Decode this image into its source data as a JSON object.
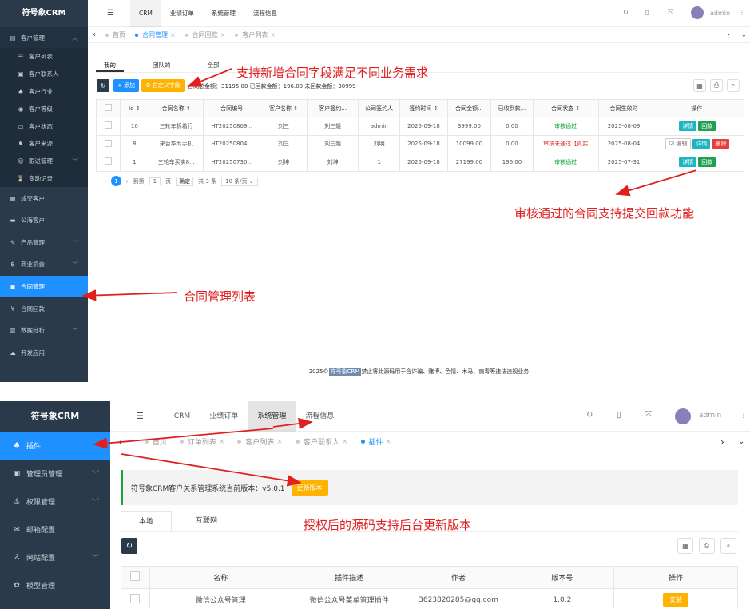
{
  "p1": {
    "logo": "符号象CRM",
    "menu": [
      {
        "label": "客户管理",
        "icon": "grid-icon",
        "chev": "︿",
        "cls": "group"
      },
      {
        "label": "客户列表",
        "icon": "list-icon",
        "cls": "sub"
      },
      {
        "label": "客户联系人",
        "icon": "contact-icon",
        "cls": "sub"
      },
      {
        "label": "客户行业",
        "icon": "industry-icon",
        "cls": "sub"
      },
      {
        "label": "客户等级",
        "icon": "level-icon",
        "cls": "sub"
      },
      {
        "label": "客户状态",
        "icon": "status-icon",
        "cls": "sub"
      },
      {
        "label": "客户来源",
        "icon": "source-icon",
        "cls": "sub"
      },
      {
        "label": "跟进管理",
        "icon": "follow-icon",
        "chev": "﹀",
        "cls": "sub"
      },
      {
        "label": "变动记录",
        "icon": "record-icon",
        "cls": "sub"
      },
      {
        "label": "成交客户",
        "icon": "deal-icon",
        "cls": "main"
      },
      {
        "label": "公海客户",
        "icon": "chart-icon",
        "cls": "main"
      },
      {
        "label": "产品管理",
        "icon": "product-icon",
        "chev": "﹀",
        "cls": "main"
      },
      {
        "label": "商业机会",
        "icon": "opportunity-icon",
        "chev": "﹀",
        "cls": "main"
      },
      {
        "label": "合同管理",
        "icon": "contract-icon",
        "cls": "main active"
      },
      {
        "label": "合同回款",
        "icon": "yen-icon",
        "cls": "main"
      },
      {
        "label": "数据分析",
        "icon": "analysis-icon",
        "chev": "﹀",
        "cls": "main"
      },
      {
        "label": "开发应用",
        "icon": "dev-icon",
        "cls": "main"
      }
    ],
    "nav": [
      "CRM",
      "业绩订单",
      "系统管理",
      "流程信息"
    ],
    "user": "admin",
    "tabs": [
      {
        "label": "首页",
        "active": false,
        "close": false
      },
      {
        "label": "合同管理",
        "active": true,
        "close": true
      },
      {
        "label": "合同回款",
        "active": false,
        "close": true
      },
      {
        "label": "客户列表",
        "active": false,
        "close": true
      }
    ],
    "subtabs": [
      "我的",
      "团队的",
      "全部"
    ],
    "add_label": "+ 添加",
    "custom_label": "⚙ 自定义字段",
    "summary": "合同总金额：31195.00  已回款金额：196.00  未回款金额：30999",
    "columns": [
      "",
      "Id ⇕",
      "合同名称 ⇕",
      "合同编号",
      "客户名称 ⇕",
      "客户签约...",
      "公司签约人",
      "签约时间 ⇕",
      "合同金额...",
      "已收到款...",
      "合同状态 ⇕",
      "合同生效时"
    ],
    "op_label": "操作",
    "rows": [
      {
        "id": "10",
        "name": "三轮车拆着行",
        "no": "HT20250809...",
        "cust": "刘三",
        "signer": "刘三姐",
        "comp": "admin",
        "date": "2025-09-18",
        "amt": "3999.00",
        "recv": "0.00",
        "status": "审核通过",
        "status_cls": "g",
        "eff": "2025-08-09",
        "ops": [
          [
            "详情",
            "blue"
          ],
          [
            "回款",
            "grn"
          ]
        ]
      },
      {
        "id": "8",
        "name": "来台华为手机",
        "no": "HT20250804...",
        "cust": "刘三",
        "signer": "刘三姐",
        "comp": "刘明",
        "date": "2025-09-18",
        "amt": "10099.00",
        "recv": "0.00",
        "status": "审核未通过【真实",
        "status_cls": "r",
        "eff": "2025-08-04",
        "ops": [
          [
            "☑ 编辑",
            "wh"
          ],
          [
            "详情",
            "blue"
          ],
          [
            "删除",
            "red"
          ]
        ]
      },
      {
        "id": "1",
        "name": "三轮车买卖8...",
        "no": "HT20250730...",
        "cust": "刘坤",
        "signer": "刘坤",
        "comp": "1",
        "date": "2025-09-18",
        "amt": "27199.00",
        "recv": "196.00",
        "status": "审核通过",
        "status_cls": "g",
        "eff": "2025-07-31",
        "ops": [
          [
            "详情",
            "blue"
          ],
          [
            "回款",
            "grn"
          ]
        ]
      }
    ],
    "pager": {
      "page": "1",
      "goto": "到第",
      "input": "1",
      "unit": "页",
      "ok": "确定",
      "total": "共 3 条",
      "size": "10 条/页 ⌄"
    },
    "footer": {
      "pre": "2025© ",
      "brand": "符号象CRM",
      "post": " 禁止将此源码用于含诈骗、赌博、色情、木马、病毒等违法违规业务"
    },
    "annotations": [
      "支持新增合同字段满足不同业务需求",
      "审核通过的合同支持提交回款功能",
      "合同管理列表"
    ]
  },
  "p2": {
    "logo": "符号象CRM",
    "menu": [
      {
        "label": "插件",
        "icon": "plugin-icon",
        "cls": "active"
      },
      {
        "label": "管理员管理",
        "icon": "admin-icon",
        "chev": "﹀"
      },
      {
        "label": "权限管理",
        "icon": "anchor-icon",
        "chev": "﹀"
      },
      {
        "label": "邮箱配置",
        "icon": "mail-icon"
      },
      {
        "label": "网站配置",
        "icon": "site-icon",
        "chev": "﹀"
      },
      {
        "label": "模型管理",
        "icon": "model-icon"
      }
    ],
    "nav": [
      "CRM",
      "业绩订单",
      "系统管理",
      "流程信息"
    ],
    "user": "admin",
    "tabs": [
      {
        "label": "首页",
        "active": false,
        "close": false
      },
      {
        "label": "订单列表",
        "active": false,
        "close": true
      },
      {
        "label": "客户列表",
        "active": false,
        "close": true
      },
      {
        "label": "客户联系人",
        "active": false,
        "close": true
      },
      {
        "label": "插件",
        "active": true,
        "close": true
      }
    ],
    "version_text": "符号象CRM客户关系管理系统当前版本：v5.0.1",
    "update_label": "更新版本",
    "subtabs": [
      "本地",
      "互联网"
    ],
    "columns": [
      "",
      "名称",
      "插件描述",
      "作者",
      "版本号",
      "操作"
    ],
    "rows": [
      {
        "name": "微信公众号管理",
        "desc": "微信公众号菜单管理插件",
        "author": "3623820285@qq.com",
        "ver": "1.0.2",
        "op": "安装"
      }
    ],
    "annotations": [
      "授权后的源码支持后台更新版本"
    ]
  },
  "colors": {
    "sidebar": "#2b3a4a",
    "active": "#1e90ff",
    "annotation": "#e02020",
    "orange": "#ffb300",
    "green": "#1aa53a"
  }
}
